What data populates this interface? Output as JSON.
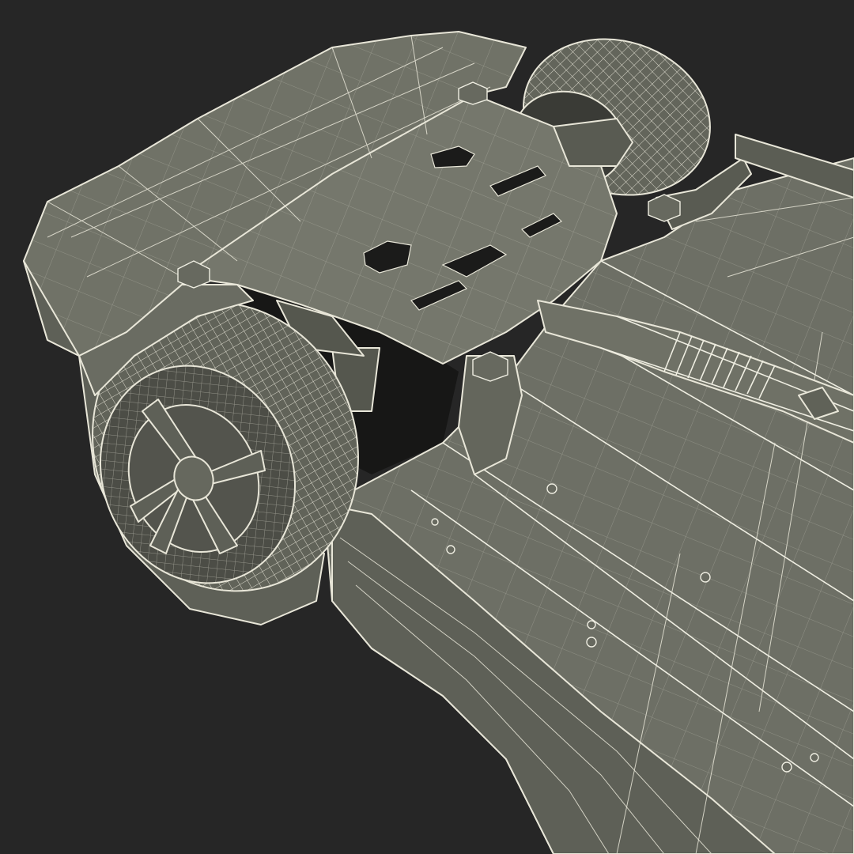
{
  "scene": {
    "subject": "car-underbody-wireframe",
    "render_style": "wireframe-on-shaded",
    "colors": {
      "background": "#262626",
      "body": "#6b6d63",
      "body_light": "#77796e",
      "body_dark": "#55574e",
      "shadow": "#1a1a19",
      "tire": "#5f6158",
      "rim": "#55564e",
      "wire": "#e8e6d8"
    }
  }
}
